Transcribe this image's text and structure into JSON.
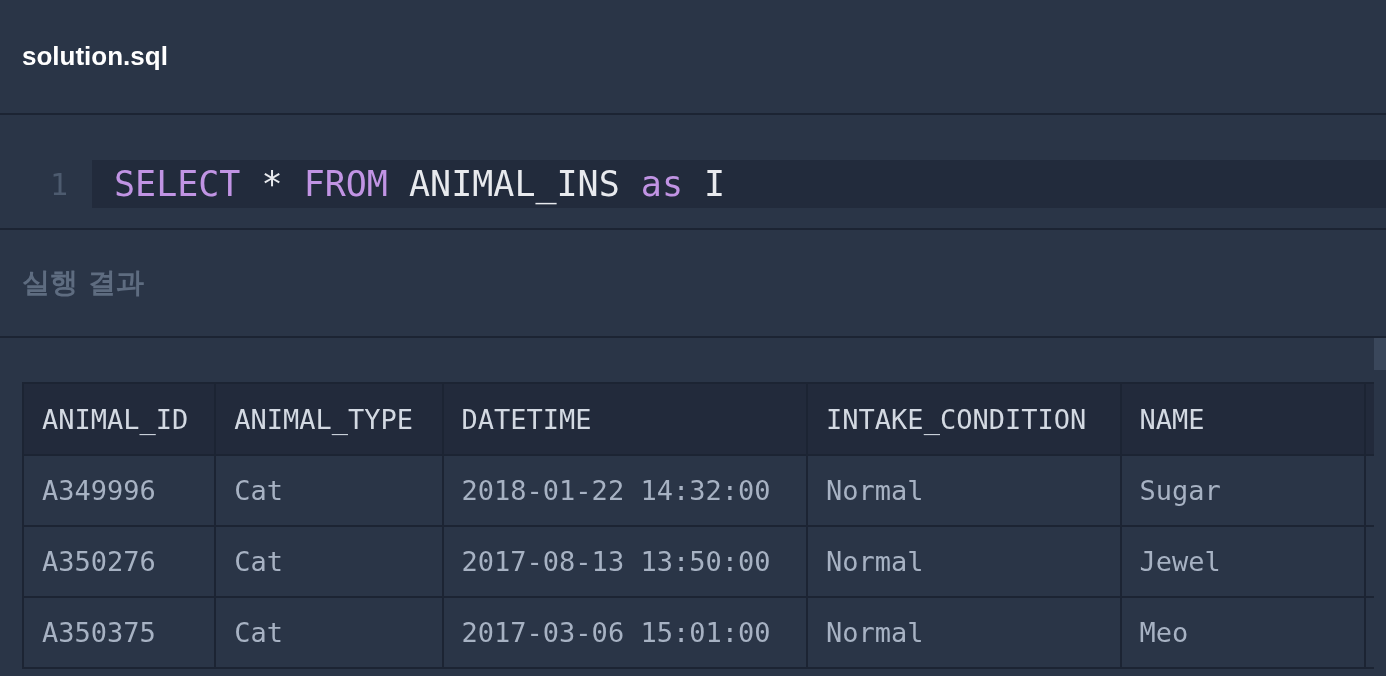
{
  "file_tab": {
    "title": "solution.sql"
  },
  "editor": {
    "lines": [
      {
        "number": "1",
        "tokens": [
          {
            "text": "SELECT",
            "kind": "keyword"
          },
          {
            "text": " * ",
            "kind": "plain"
          },
          {
            "text": "FROM",
            "kind": "keyword"
          },
          {
            "text": " ANIMAL_INS ",
            "kind": "plain"
          },
          {
            "text": "as",
            "kind": "keyword"
          },
          {
            "text": " I",
            "kind": "plain"
          }
        ]
      }
    ]
  },
  "results": {
    "title": "실행 결과",
    "table": {
      "columns": [
        "ANIMAL_ID",
        "ANIMAL_TYPE",
        "DATETIME",
        "INTAKE_CONDITION",
        "NAME"
      ],
      "rows": [
        [
          "A349996",
          "Cat",
          "2018-01-22 14:32:00",
          "Normal",
          "Sugar"
        ],
        [
          "A350276",
          "Cat",
          "2017-08-13 13:50:00",
          "Normal",
          "Jewel"
        ],
        [
          "A350375",
          "Cat",
          "2017-03-06 15:01:00",
          "Normal",
          "Meo"
        ]
      ]
    }
  }
}
